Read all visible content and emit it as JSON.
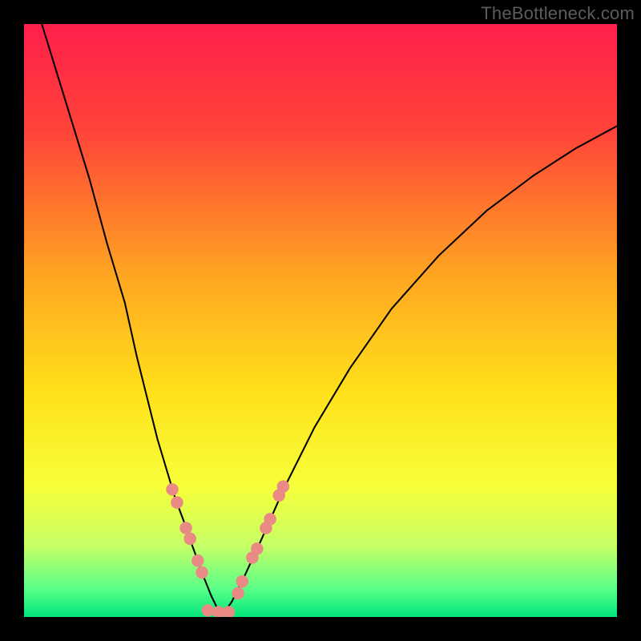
{
  "watermark": "TheBottleneck.com",
  "chart_data": {
    "type": "line",
    "title": "",
    "xlabel": "",
    "ylabel": "",
    "xlim": [
      0,
      100
    ],
    "ylim": [
      0,
      100
    ],
    "grid": false,
    "legend": false,
    "background_gradient_stops": [
      {
        "offset": 0.0,
        "color": "#ff1f4b"
      },
      {
        "offset": 0.18,
        "color": "#ff4339"
      },
      {
        "offset": 0.42,
        "color": "#ffa421"
      },
      {
        "offset": 0.62,
        "color": "#ffe11a"
      },
      {
        "offset": 0.78,
        "color": "#f7ff3a"
      },
      {
        "offset": 0.88,
        "color": "#c6ff66"
      },
      {
        "offset": 0.955,
        "color": "#55ff88"
      },
      {
        "offset": 1.0,
        "color": "#00e57a"
      }
    ],
    "series": [
      {
        "name": "left-branch",
        "color": "#000000",
        "x": [
          3,
          7,
          11,
          14,
          17,
          19,
          21,
          22.5,
          24,
          25.5,
          27,
          28.2,
          29.3,
          30.2,
          31,
          31.6,
          32.2,
          32.6,
          33,
          33.3
        ],
        "y": [
          100,
          87,
          74,
          63,
          53,
          44,
          36,
          30,
          25,
          20,
          16,
          12.5,
          9.5,
          7,
          5,
          3.5,
          2.3,
          1.4,
          0.7,
          0.2
        ]
      },
      {
        "name": "right-branch",
        "color": "#000000",
        "x": [
          33.3,
          35,
          37,
          40,
          44,
          49,
          55,
          62,
          70,
          78,
          86,
          93,
          100
        ],
        "y": [
          0.2,
          2.5,
          6.5,
          13,
          22,
          32,
          42,
          52,
          61,
          68.5,
          74.5,
          79,
          82.8
        ]
      }
    ],
    "marker_series": {
      "name": "dots",
      "color": "#e98a84",
      "radius_pct": 1.05,
      "points": [
        {
          "x": 25.0,
          "y": 21.5
        },
        {
          "x": 25.8,
          "y": 19.3
        },
        {
          "x": 27.3,
          "y": 15.0
        },
        {
          "x": 28.0,
          "y": 13.2
        },
        {
          "x": 29.3,
          "y": 9.5
        },
        {
          "x": 30.0,
          "y": 7.5
        },
        {
          "x": 31.0,
          "y": 1.1
        },
        {
          "x": 32.8,
          "y": 0.8
        },
        {
          "x": 34.5,
          "y": 0.8
        },
        {
          "x": 36.1,
          "y": 4.0
        },
        {
          "x": 36.8,
          "y": 6.0
        },
        {
          "x": 38.5,
          "y": 10.0
        },
        {
          "x": 39.3,
          "y": 11.5
        },
        {
          "x": 40.8,
          "y": 15.0
        },
        {
          "x": 41.5,
          "y": 16.5
        },
        {
          "x": 43.0,
          "y": 20.5
        },
        {
          "x": 43.7,
          "y": 22.0
        }
      ]
    }
  }
}
